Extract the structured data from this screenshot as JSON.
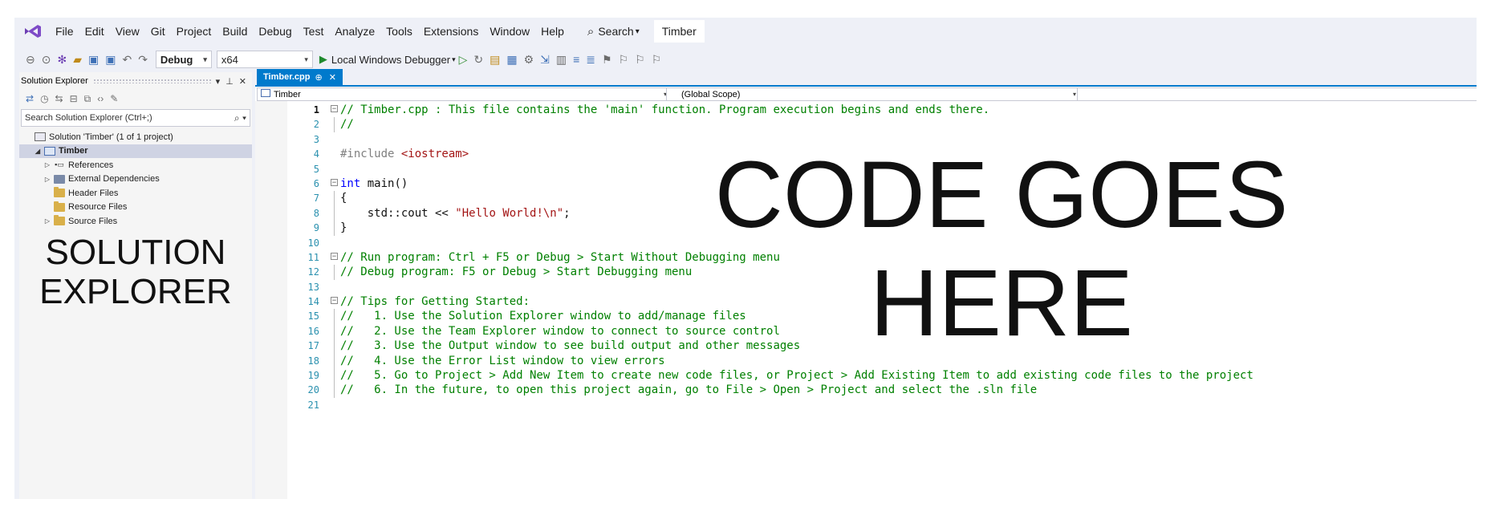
{
  "window": {
    "solution_title": "Timber"
  },
  "menu": [
    "File",
    "Edit",
    "View",
    "Git",
    "Project",
    "Build",
    "Debug",
    "Test",
    "Analyze",
    "Tools",
    "Extensions",
    "Window",
    "Help"
  ],
  "search": {
    "label": "Search"
  },
  "toolbar": {
    "configuration": "Debug",
    "platform": "x64",
    "debugger_label": "Local Windows Debugger"
  },
  "solution_explorer": {
    "title": "Solution Explorer",
    "search_placeholder": "Search Solution Explorer (Ctrl+;)",
    "tree": [
      {
        "label": "Solution 'Timber' (1 of 1 project)",
        "icon": "solution-icon",
        "indent": 0,
        "twisty": ""
      },
      {
        "label": "Timber",
        "icon": "project-icon",
        "indent": 1,
        "twisty": "expanded",
        "selected": true
      },
      {
        "label": "References",
        "icon": "references-icon",
        "indent": 2,
        "twisty": "collapsed"
      },
      {
        "label": "External Dependencies",
        "icon": "external-dependencies-icon",
        "indent": 2,
        "twisty": "collapsed"
      },
      {
        "label": "Header Files",
        "icon": "folder-icon",
        "indent": 2,
        "twisty": ""
      },
      {
        "label": "Resource Files",
        "icon": "folder-icon",
        "indent": 2,
        "twisty": ""
      },
      {
        "label": "Source Files",
        "icon": "folder-icon",
        "indent": 2,
        "twisty": "collapsed"
      }
    ],
    "overlay_line1": "SOLUTION",
    "overlay_line2": "EXPLORER"
  },
  "editor": {
    "tab_label": "Timber.cpp",
    "nav_project": "Timber",
    "nav_scope": "(Global Scope)",
    "lines": [
      {
        "n": "1",
        "fold": "minus",
        "segs": [
          {
            "c": "c",
            "t": "// Timber.cpp : This file contains the 'main' function. Program execution begins and ends there."
          }
        ]
      },
      {
        "n": "2",
        "guide": true,
        "segs": [
          {
            "c": "c",
            "t": "//"
          }
        ]
      },
      {
        "n": "3",
        "segs": []
      },
      {
        "n": "4",
        "segs": [
          {
            "c": "p",
            "t": "#include "
          },
          {
            "c": "s",
            "t": "<iostream>"
          }
        ]
      },
      {
        "n": "5",
        "segs": []
      },
      {
        "n": "6",
        "fold": "minus",
        "segs": [
          {
            "c": "k",
            "t": "int"
          },
          {
            "c": "t",
            "t": " main()"
          }
        ]
      },
      {
        "n": "7",
        "guide": true,
        "segs": [
          {
            "c": "t",
            "t": "{"
          }
        ]
      },
      {
        "n": "8",
        "guide": true,
        "segs": [
          {
            "c": "t",
            "t": "    std::cout << "
          },
          {
            "c": "s",
            "t": "\"Hello World!\\n\""
          },
          {
            "c": "t",
            "t": ";"
          }
        ]
      },
      {
        "n": "9",
        "guide": true,
        "segs": [
          {
            "c": "t",
            "t": "}"
          }
        ]
      },
      {
        "n": "10",
        "segs": []
      },
      {
        "n": "11",
        "fold": "minus",
        "segs": [
          {
            "c": "c",
            "t": "// Run program: Ctrl + F5 or Debug > Start Without Debugging menu"
          }
        ]
      },
      {
        "n": "12",
        "guide": true,
        "segs": [
          {
            "c": "c",
            "t": "// Debug program: F5 or Debug > Start Debugging menu"
          }
        ]
      },
      {
        "n": "13",
        "segs": []
      },
      {
        "n": "14",
        "fold": "minus",
        "segs": [
          {
            "c": "c",
            "t": "// Tips for Getting Started:"
          }
        ]
      },
      {
        "n": "15",
        "guide": true,
        "segs": [
          {
            "c": "c",
            "t": "//   1. Use the Solution Explorer window to add/manage files"
          }
        ]
      },
      {
        "n": "16",
        "guide": true,
        "segs": [
          {
            "c": "c",
            "t": "//   2. Use the Team Explorer window to connect to source control"
          }
        ]
      },
      {
        "n": "17",
        "guide": true,
        "segs": [
          {
            "c": "c",
            "t": "//   3. Use the Output window to see build output and other messages"
          }
        ]
      },
      {
        "n": "18",
        "guide": true,
        "segs": [
          {
            "c": "c",
            "t": "//   4. Use the Error List window to view errors"
          }
        ]
      },
      {
        "n": "19",
        "guide": true,
        "segs": [
          {
            "c": "c",
            "t": "//   5. Go to Project > Add New Item to create new code files, or Project > Add Existing Item to add existing code files to the project"
          }
        ]
      },
      {
        "n": "20",
        "guide": true,
        "segs": [
          {
            "c": "c",
            "t": "//   6. In the future, to open this project again, go to File > Open > Project and select the .sln file"
          }
        ]
      },
      {
        "n": "21",
        "segs": []
      }
    ],
    "overlay_line1": "CODE GOES",
    "overlay_line2": "HERE"
  },
  "colors": {
    "accent": "#007acc",
    "comment": "#008000",
    "keyword": "#0000ff",
    "string": "#a31515",
    "line_number": "#2b91af"
  }
}
